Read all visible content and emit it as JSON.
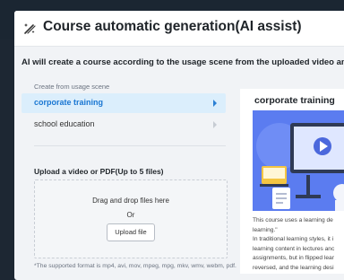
{
  "dialog": {
    "title": "Course automatic generation(AI assist)",
    "subtitle": "AI will create a course according to the usage scene from the uploaded video and PDF",
    "icon": "magic-wand-icon"
  },
  "scenes": {
    "label": "Create from usage scene",
    "items": [
      {
        "label": "corporate training",
        "active": true
      },
      {
        "label": "school education",
        "active": false
      }
    ]
  },
  "upload": {
    "label": "Upload a video or PDF(Up to 5 files)",
    "drop_text": "Drag and drop files here",
    "or_text": "Or",
    "button_label": "Upload file",
    "format_note": "*The supported format is mp4, avi, mov, mpeg, mpg, mkv, wmv, webm, pdf."
  },
  "preview": {
    "title": "corporate training",
    "description_lines": [
      "This course uses a learning de",
      "learning.\"",
      "In traditional learning styles, it i",
      "learning content in lectures anc",
      "assignments, but in flipped lear",
      "reversed, and the learning desi"
    ]
  },
  "colors": {
    "accent": "#1976d2",
    "active_bg": "#dbeefc",
    "illustration_bg": "#5b7cf0",
    "modal_bg": "#f1f3f6"
  }
}
